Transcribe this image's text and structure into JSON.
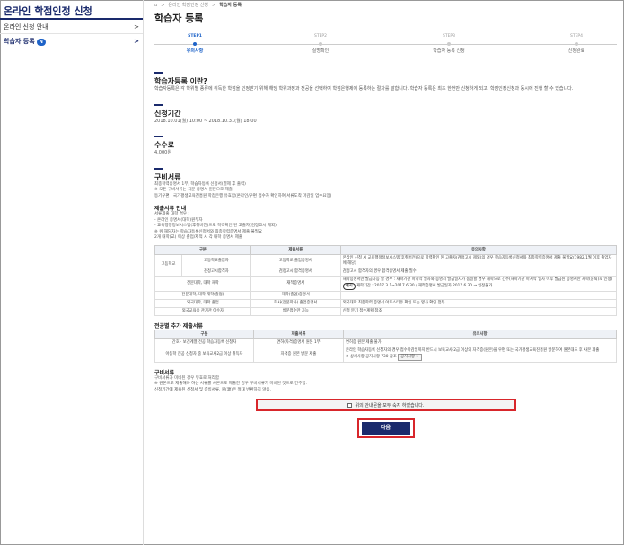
{
  "sidebar": {
    "title": "온라인 학점인정 신청",
    "items": [
      {
        "label": "온라인 신청 안내",
        "arrow": ">"
      },
      {
        "label": "학습자 등록",
        "badge": "N",
        "arrow": ">"
      }
    ]
  },
  "breadcrumb": {
    "home": "⌂",
    "sep": ">",
    "level1": "온라인 학점인정 신청",
    "current": "학습자 등록"
  },
  "page_title": "학습자 등록",
  "steps": [
    {
      "num": "STEP1",
      "label": "유의사항"
    },
    {
      "num": "STEP2",
      "label": "실명확인"
    },
    {
      "num": "STEP3",
      "label": "학습자 등록 신청"
    },
    {
      "num": "STEP4",
      "label": "신청완료"
    }
  ],
  "about": {
    "title": "학습자등록 이란?",
    "body": "학습자등록은 각 학위별 종류에 취득한 학점을 인정받기 위해 해당 학위과정과 전공을 선택하여 학점은행제에 등록하는 절차를 말합니다. 학습자 등록은 최초 한번만 신청하게 되고, 학점인정신청과 동시에 진행 할 수 있습니다."
  },
  "period": {
    "title": "신청기간",
    "body": "2018.10.01(월) 10:00 ~ 2018.10.31(월) 18:00"
  },
  "fee": {
    "title": "수수료",
    "body": "4,000원"
  },
  "docs": {
    "title": "구비서류",
    "items": [
      "최종학력증명서 1부, 학습자등록 신청서(결제 후 출력)",
      "※ 모든 구비서류는 국문 증명서 원본으로 제출",
      "등기우편 : 국가평생교육진흥원 학점은행 유효함(온라인/우편 접수자 확인하여 서류도착 마감일 엄수요망)"
    ]
  },
  "submit": {
    "title": "제출서류 안내",
    "items": [
      "서류제출 대학 경우 :",
      "- 온라인 증명서(대학)원부자",
      "- 교육행정정보시스템(후취버전)으로 학력확인 된 고졸자(검정고시 제외)",
      "※ 위 해당자는 학습자등록신청서와 최종학력증명서 제출 불필요",
      "2개 대학(교) 이상 졸업/제적 시 각 대학 증명서 제출"
    ]
  },
  "table1": {
    "headers": [
      "구분",
      "제출서류",
      "유의사항"
    ],
    "rows": [
      {
        "c1": "고등학교",
        "c2": "고등학교졸업자",
        "c3": "고등학교 졸업증명서",
        "c4": "온라인 신청 시 교육행정정보시스템(후취버전)으로 학력확인 된 고졸자(검정고시 제외)의 경우 학습자등록신청서와 최종학력증명서 제출 불필요(1982.1월 이후 졸업자에 해당)"
      },
      {
        "c1": "",
        "c2": "검정고시합격자",
        "c3": "검정고시 합격증명서",
        "c4": "검정고시 합격자의 경우 합격증명서 제출 필수"
      },
      {
        "c1": "전문대학, 대학 재학",
        "c2": "",
        "c3": "재적증명서",
        "c4": "재학증명서만 발급가능 할 경우 : 재학기간 마지막 일자와 증명서 발급일자가 동일할 경우 재학으로 간주(재학기간 마지막 일자 이후 발급된 증명서만 재학(중퇴)로 인정)",
        "ex_tag": "예시",
        "ex": "재학기간 : 2017.3.1~2017.6.30 / 재적증명서 발급일자 2017.6.30 → 인정불가"
      },
      {
        "c1": "전문대학, 대학 재학(졸업)",
        "c2": "",
        "c3": "재학(졸업)증명서",
        "c4": ""
      },
      {
        "c1": "외국대학, 대학 졸업",
        "c2": "",
        "c3": "학사(전문학사) 졸업증명서",
        "c4": "외국대학 최종학력 증명서 아포스티유 확인 또는 영사 확인 첨부"
      },
      {
        "c1": "외국교육중 관기관 이수자",
        "c2": "",
        "c3": "방문접수만 가능",
        "c4": "신청 분기 접수계획 참조"
      }
    ]
  },
  "major": {
    "title": "전공별 추가 제출서류",
    "headers": [
      "구분",
      "제출서류",
      "유의사항"
    ],
    "rows": [
      {
        "c1": "간호 · 보건계열 전공 학습자등록 신청자",
        "c2": "면허(자격)증명서 원본 1부",
        "c3": "면허증 원본 제출 불가"
      },
      {
        "c1": "아동학 전공 신청자 중 보육교사2급 이상 취득자",
        "c2": "자격증 원본 방문 제출",
        "c3": "온라인 학습자등록 신청자의 경우 접수마감일까지 반드시 보육교사 2급 이상의 자격증(원본)을 우편 또는 국가평생교육진흥원 방문하여 원본대조 후 사본 제출",
        "note": "※ 상세사항 공지사항 730 참조",
        "btn": "공지사항 >"
      }
    ]
  },
  "docs2": {
    "title": "구비서류",
    "items": [
      "구비서류가 미비된 경우 무효로 처리함",
      "※ 원본으로 제출해야 하는 서류를 사본으로 제출한 경우 구비서류가 미비된 것으로 간주함.",
      "신청기간에 제출된 신청서 및 증빙서류, 원(源)은 절대 반환하지 않음."
    ]
  },
  "agree_label": "위의 안내문을 모두 숙지 하였습니다.",
  "next_label": "다음"
}
